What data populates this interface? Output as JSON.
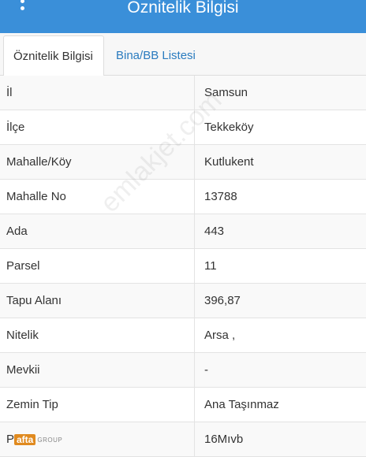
{
  "header": {
    "title": "Öznitelik Bilgisi",
    "menu_icon": "vertical-dots-icon"
  },
  "tabs": [
    {
      "label": "Öznitelik Bilgisi",
      "active": true
    },
    {
      "label": "Bina/BB Listesi",
      "active": false
    }
  ],
  "rows": [
    {
      "label": "İl",
      "value": "Samsun"
    },
    {
      "label": "İlçe",
      "value": "Tekkeköy"
    },
    {
      "label": "Mahalle/Köy",
      "value": "Kutlukent"
    },
    {
      "label": "Mahalle No",
      "value": "13788"
    },
    {
      "label": "Ada",
      "value": "443"
    },
    {
      "label": "Parsel",
      "value": "11"
    },
    {
      "label": "Tapu Alanı",
      "value": "396,87"
    },
    {
      "label": "Nitelik",
      "value": "Arsa ,"
    },
    {
      "label": "Mevkii",
      "value": "-"
    },
    {
      "label": "Zemin Tip",
      "value": "Ana Taşınmaz"
    },
    {
      "label": "Pafta",
      "value": "16Mıvb"
    }
  ],
  "watermark": "emlakjet.com",
  "logo": {
    "mark": "afta",
    "text": "GROUP"
  },
  "colors": {
    "header_bg": "#3a8fd9",
    "tab_link": "#2a7bbf",
    "row_alt": "#f9f9f9",
    "border": "#e3e3e3"
  }
}
